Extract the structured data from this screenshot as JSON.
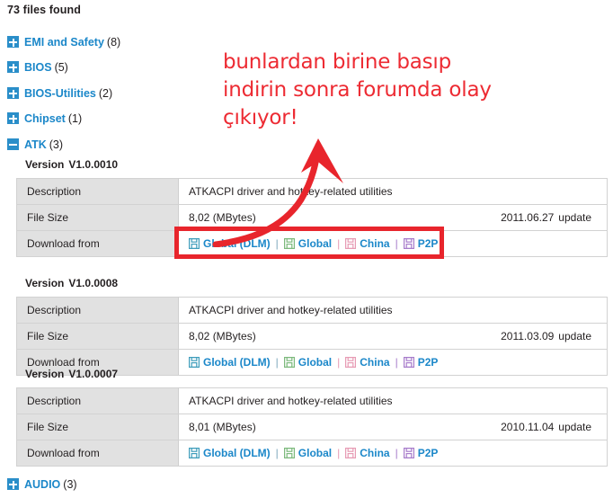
{
  "header": {
    "files_found": "73 files found"
  },
  "categories": [
    {
      "name": "EMI and Safety",
      "count": "(8)",
      "state": "collapsed",
      "toggle_icon": "plus-icon"
    },
    {
      "name": "BIOS",
      "count": "(5)",
      "state": "collapsed",
      "toggle_icon": "plus-icon"
    },
    {
      "name": "BIOS-Utilities",
      "count": "(2)",
      "state": "collapsed",
      "toggle_icon": "plus-icon"
    },
    {
      "name": "Chipset",
      "count": "(1)",
      "state": "collapsed",
      "toggle_icon": "plus-icon"
    },
    {
      "name": "ATK",
      "count": "(3)",
      "state": "expanded",
      "toggle_icon": "minus-icon"
    }
  ],
  "footer_category": {
    "name": "AUDIO",
    "count": "(3)",
    "state": "collapsed",
    "toggle_icon": "plus-icon"
  },
  "row_labels": {
    "description": "Description",
    "file_size": "File Size",
    "download_from": "Download from"
  },
  "version_word": "Version",
  "update_word": "update",
  "versions": [
    {
      "version": "V1.0.0010",
      "description": "ATKACPI driver and hotkey-related utilities",
      "file_size": "8,02 (MBytes)",
      "update_date": "2011.06.27",
      "links": [
        {
          "label": "Global (DLM)",
          "icon": "floppy-disk-icon",
          "color": "#3f9dbb"
        },
        {
          "label": "Global",
          "icon": "floppy-disk-icon",
          "color": "#7cb97c"
        },
        {
          "label": "China",
          "icon": "floppy-disk-icon",
          "color": "#e79bb4"
        },
        {
          "label": "P2P",
          "icon": "floppy-disk-icon",
          "color": "#a77ccb"
        }
      ]
    },
    {
      "version": "V1.0.0008",
      "description": "ATKACPI driver and hotkey-related utilities",
      "file_size": "8,02 (MBytes)",
      "update_date": "2011.03.09",
      "links": [
        {
          "label": "Global (DLM)",
          "icon": "floppy-disk-icon",
          "color": "#3f9dbb"
        },
        {
          "label": "Global",
          "icon": "floppy-disk-icon",
          "color": "#7cb97c"
        },
        {
          "label": "China",
          "icon": "floppy-disk-icon",
          "color": "#e79bb4"
        },
        {
          "label": "P2P",
          "icon": "floppy-disk-icon",
          "color": "#a77ccb"
        }
      ]
    },
    {
      "version": "V1.0.0007",
      "description": "ATKACPI driver and hotkey-related utilities",
      "file_size": "8,01 (MBytes)",
      "update_date": "2010.11.04",
      "links": [
        {
          "label": "Global (DLM)",
          "icon": "floppy-disk-icon",
          "color": "#3f9dbb"
        },
        {
          "label": "Global",
          "icon": "floppy-disk-icon",
          "color": "#7cb97c"
        },
        {
          "label": "China",
          "icon": "floppy-disk-icon",
          "color": "#e79bb4"
        },
        {
          "label": "P2P",
          "icon": "floppy-disk-icon",
          "color": "#a77ccb"
        }
      ]
    }
  ],
  "annotation": {
    "line1": "bunlardan birine basıp",
    "line2": "indirin sonra forumda olay",
    "line3": "çıkıyor!",
    "color": "#ed2b33",
    "highlight_color": "#e8252c"
  },
  "link_separator": "|",
  "colors": {
    "link_blue": "#1b87c9",
    "toggle_blue": "#2a8ec9",
    "label_cell_bg": "#e1e1e1",
    "border": "#d2d2d2",
    "text": "#231f20"
  }
}
